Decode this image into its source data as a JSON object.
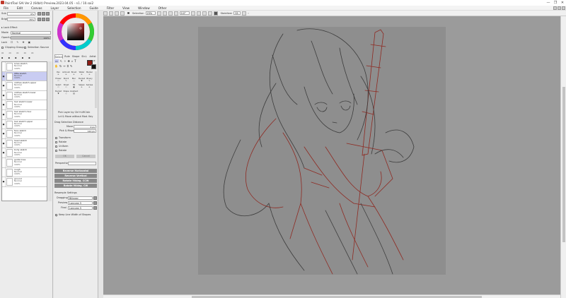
{
  "window": {
    "title": "PaintTool SAI Ver.2 (64bit) Preview.2023.04.05 - n1 / 10.sai2",
    "controls": [
      "—",
      "❐",
      "✕"
    ]
  },
  "menu": {
    "items": [
      "File",
      "Edit",
      "Canvas",
      "Layer",
      "Selection",
      "Guide",
      "Filter",
      "View",
      "Window",
      "Other"
    ]
  },
  "toolbar": {
    "selection_label": "Selection",
    "zoom_value": "23%",
    "angle_value": "0.0°",
    "stabilizer_label": "Stabilizer",
    "stabilizer_value": "S5"
  },
  "left_panel": {
    "hue_label": "Sub",
    "hue_value": "0%",
    "bright_label": "Bright",
    "bright_value": "35%",
    "lock_effect": "Lock Effect",
    "mode_label": "Mode",
    "mode_value": "Normal",
    "opacity_label": "Opacity",
    "opacity_value": "100%",
    "lock_label": "Lock",
    "clipping_group": "Clipping Group",
    "selection_source": "Selection Source"
  },
  "layers": [
    {
      "name": "Lines sketch",
      "mode": "Normal",
      "opacity": "100%",
      "selected": false
    },
    {
      "name": "little sketch",
      "mode": "Normal",
      "opacity": "100%",
      "selected": true
    },
    {
      "name": "clothes sketch upper",
      "mode": "Normal",
      "opacity": "100%",
      "selected": false
    },
    {
      "name": "clothes sketch lower",
      "mode": "Normal",
      "opacity": "100%",
      "selected": false
    },
    {
      "name": "hair sketch lower",
      "mode": "Normal",
      "opacity": "100%",
      "selected": false
    },
    {
      "name": "hair sketch misc",
      "mode": "Normal",
      "opacity": "100%",
      "selected": false
    },
    {
      "name": "hair sketch upper",
      "mode": "Normal",
      "opacity": "100%",
      "selected": false
    },
    {
      "name": "face sketch",
      "mode": "Normal",
      "opacity": "100%",
      "selected": false
    },
    {
      "name": "head sketch",
      "mode": "Normal",
      "opacity": "100%",
      "selected": false
    },
    {
      "name": "body sketch",
      "mode": "Normal",
      "opacity": "100%",
      "selected": false
    },
    {
      "name": "guide lines",
      "mode": "Normal",
      "opacity": "100%",
      "selected": false
    },
    {
      "name": "rough",
      "mode": "Normal",
      "opacity": "100%",
      "selected": false
    },
    {
      "name": "ground",
      "mode": "Normal",
      "opacity": "100%",
      "selected": false
    }
  ],
  "tool_panel": {
    "tabs": [
      "Select",
      "Rule",
      "Shape",
      "Str.L",
      "Artist"
    ],
    "brush_names": [
      "Pen",
      "Airbrush",
      "Brush",
      "Water",
      "Marker",
      "Eraser",
      "Pencil",
      "Blur",
      "Bucket",
      "Binary",
      "Select",
      "Sheet",
      "Fill",
      "Selpen",
      "Selrase",
      "Bucket",
      "Shape",
      "Gradient"
    ],
    "pick_layer_hint": "Pick Layer by Ctrl+LMClick",
    "lock_move_hint": "Lct & Move without Mod. Key",
    "drag_section": "Drag Selection Distance",
    "move_label": "Move",
    "move_value": "4 px",
    "pick_label": "Pick & Move",
    "pick_value": "120 px",
    "options": [
      "Transform",
      "Rotate",
      "Uniform",
      "Rotate"
    ],
    "ok_label": "OK",
    "cancel_label": "Cancel",
    "perspective_label": "Perspective",
    "buttons": [
      "Reverse Horizontal",
      "Reverse Vertical",
      "Rotate 90deg. CCW",
      "Rotate 90deg. CW"
    ],
    "resample_label": "Resample Settings",
    "dragging_label": "Dragging",
    "dragging_value": "Bilinear",
    "preview_label": "Preview",
    "preview_value": "Lanczos 3",
    "final_label": "Final",
    "final_value": "Lanczos 3",
    "keep_line_width": "Keep Line Width of Shapes"
  },
  "colors": {
    "main_color": "#8b1c14",
    "sub_color": "#111111",
    "canvas_bg": "#9b9b9b",
    "doc_bg": "#8e8e8e",
    "sketch_red": "#8f2a22",
    "sketch_dark": "#3d3d3d"
  }
}
